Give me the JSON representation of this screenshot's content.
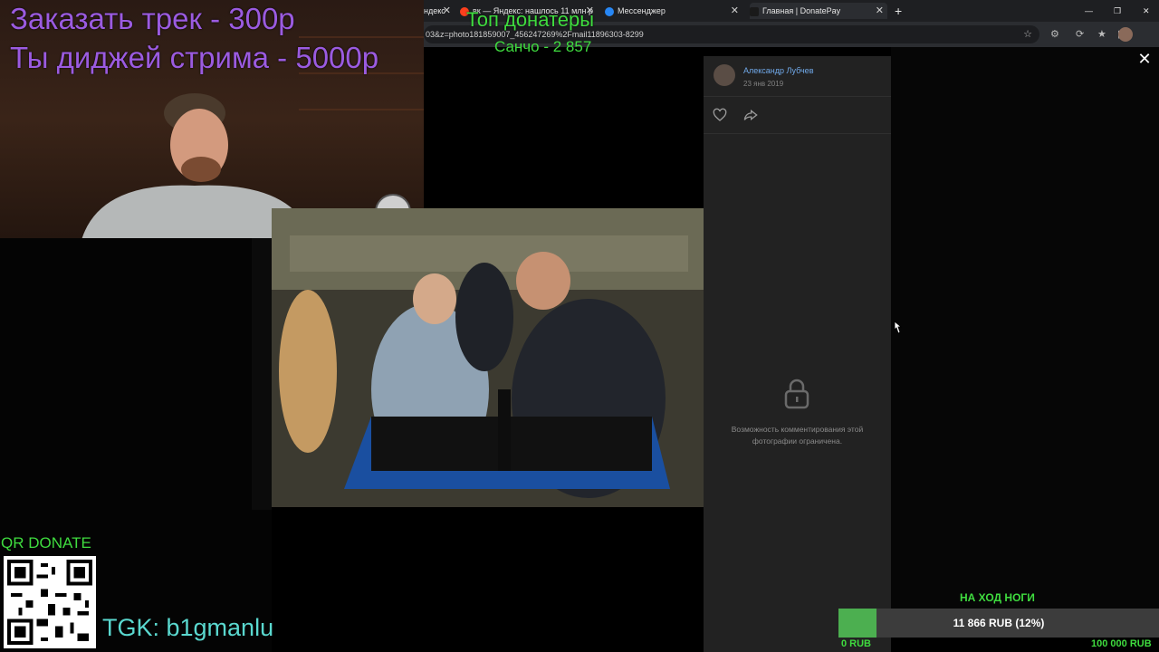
{
  "browser": {
    "tabs": [
      {
        "label": "ндекс",
        "favicon": "yandex-icon",
        "active": false
      },
      {
        "label": "вк — Яндекс: нашлось 11 млн р",
        "favicon": "yandex-icon",
        "active": false
      },
      {
        "label": "Мессенджер",
        "favicon": "vk-messenger-icon",
        "active": false
      },
      {
        "label": "Главная | DonatePay",
        "favicon": "donatepay-icon",
        "active": true
      }
    ],
    "address": "03&z=photo181859007_456247269%2Fmail11896303-8299"
  },
  "overlays": {
    "order_track": "Заказать трек - 300р",
    "dj_stream": "Ты диджей стрима - 5000р",
    "top_donaters_title": "Топ донатеры",
    "top_donaters_entry": "Санчо - 2 857",
    "qr_label": "QR DONATE",
    "tgk": "TGK: b1gmanlu"
  },
  "photo_viewer": {
    "author": "Александр Лубчев",
    "date": "23 янв 2019",
    "comments_restricted": "Возможность комментирования этой фотографии ограничена.",
    "icons": [
      "like-icon",
      "share-icon",
      "lock-icon",
      "close-icon"
    ]
  },
  "goal": {
    "title": "НА ХОД НОГИ",
    "progress_text": "11 866 RUB (12%)",
    "progress_fraction": 0.12,
    "min_label": "0 RUB",
    "max_label": "100 000 RUB"
  },
  "colors": {
    "overlay_purple": "#9b5be0",
    "overlay_green": "#3fdc3f",
    "tgk_cyan": "#5ad8cf",
    "goal_fill": "#4caf50",
    "vk_link": "#71aaeb"
  }
}
